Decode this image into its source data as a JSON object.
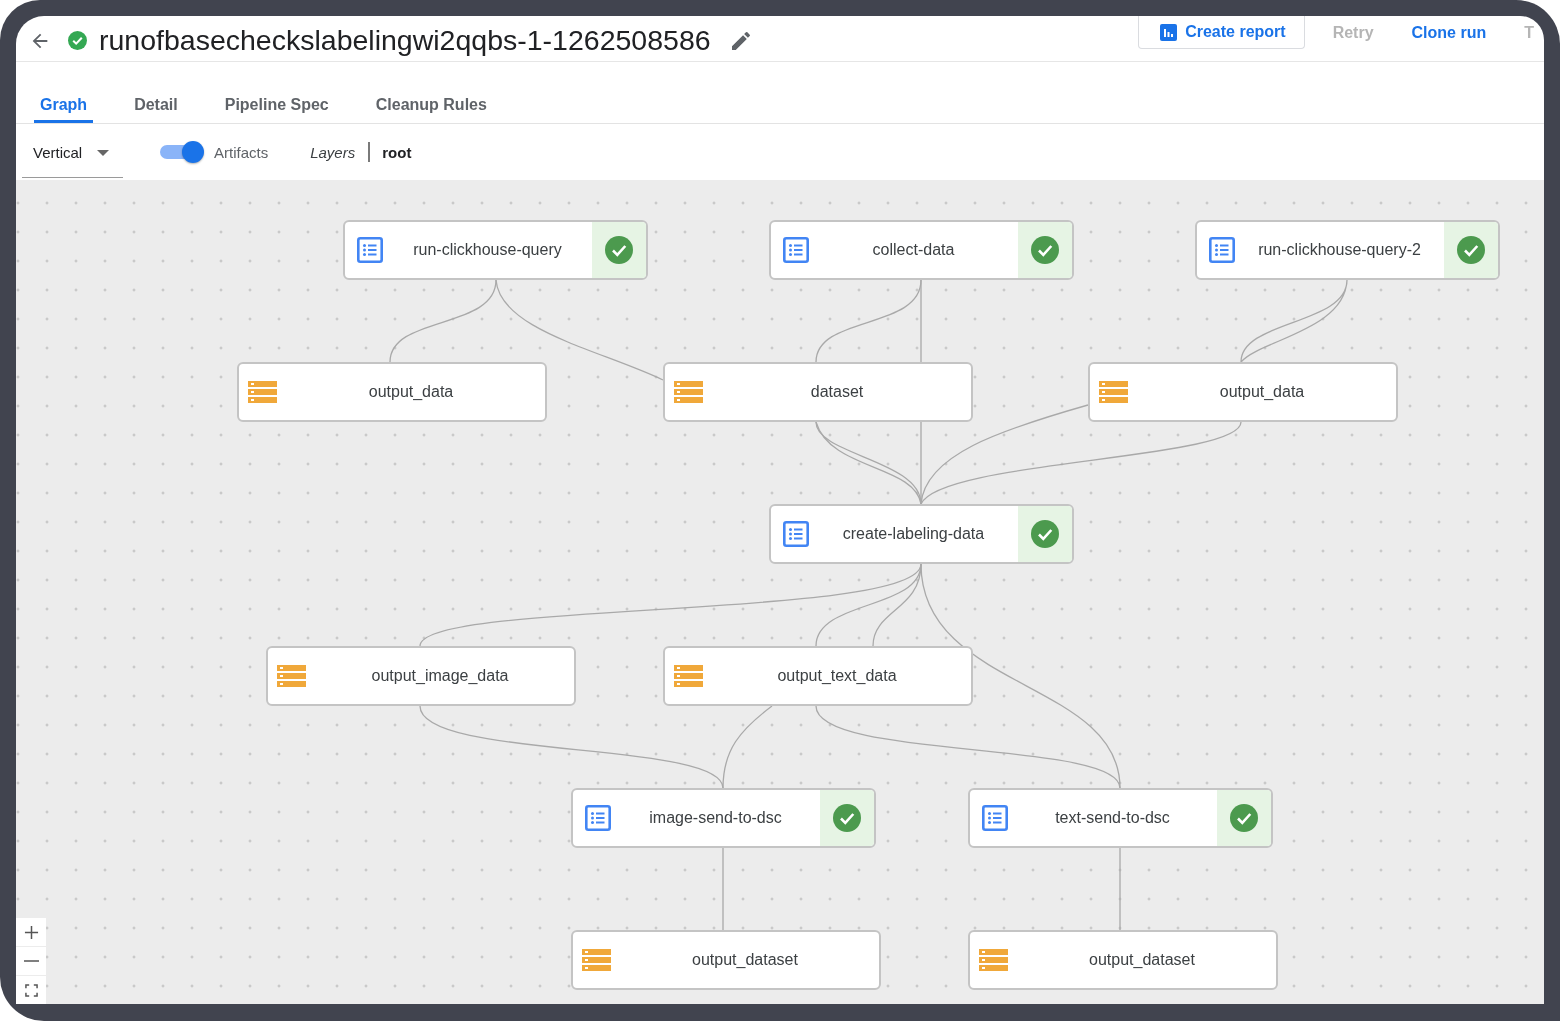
{
  "run": {
    "title": "runofbasecheckslabelingwi2qqbs-1-1262508586",
    "succeeded": true
  },
  "actions": [
    {
      "label": "Create report",
      "kind": "outlined",
      "disabled": false
    },
    {
      "label": "Retry",
      "kind": "text",
      "disabled": true
    },
    {
      "label": "Clone run",
      "kind": "text",
      "disabled": false
    },
    {
      "label": "T",
      "kind": "text",
      "disabled": true
    }
  ],
  "tabs": [
    {
      "label": "Graph",
      "selected": true
    },
    {
      "label": "Detail",
      "selected": false
    },
    {
      "label": "Pipeline Spec",
      "selected": false
    },
    {
      "label": "Cleanup Rules",
      "selected": false
    }
  ],
  "toolbar": {
    "layout": {
      "value": "Vertical"
    },
    "artifacts": {
      "label": "Artifacts",
      "on": true
    },
    "layers": {
      "label": "Layers",
      "value": "root"
    }
  },
  "graph": {
    "nodes": [
      {
        "kind": "execution",
        "label": "run-clickhouse-query",
        "succeeded": true
      },
      {
        "kind": "execution",
        "label": "collect-data",
        "succeeded": true
      },
      {
        "kind": "execution",
        "label": "run-clickhouse-query-2",
        "succeeded": true
      },
      {
        "kind": "artifact",
        "label": "output_data"
      },
      {
        "kind": "artifact",
        "label": "dataset"
      },
      {
        "kind": "artifact",
        "label": "output_data"
      },
      {
        "kind": "execution",
        "label": "create-labeling-data",
        "succeeded": true
      },
      {
        "kind": "artifact",
        "label": "output_image_data"
      },
      {
        "kind": "artifact",
        "label": "output_text_data"
      },
      {
        "kind": "execution",
        "label": "image-send-to-dsc",
        "succeeded": true
      },
      {
        "kind": "execution",
        "label": "text-send-to-dsc",
        "succeeded": true
      },
      {
        "kind": "artifact",
        "label": "output_dataset"
      },
      {
        "kind": "artifact",
        "label": "output_dataset"
      }
    ]
  }
}
